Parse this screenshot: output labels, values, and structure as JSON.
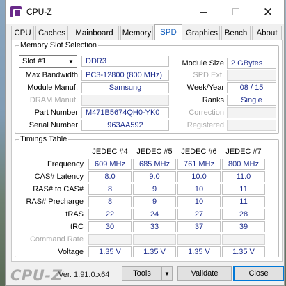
{
  "window": {
    "title": "CPU-Z",
    "minimize": "—",
    "maximize": "☐",
    "close": "✕"
  },
  "tabs": [
    "CPU",
    "Caches",
    "Mainboard",
    "Memory",
    "SPD",
    "Graphics",
    "Bench",
    "About"
  ],
  "active_tab": "SPD",
  "memory_slot": {
    "group_title": "Memory Slot Selection",
    "slot_selected": "Slot #1",
    "type": "DDR3",
    "labels": {
      "max_bandwidth": "Max Bandwidth",
      "module_manuf": "Module Manuf.",
      "dram_manuf": "DRAM Manuf.",
      "part_number": "Part Number",
      "serial_number": "Serial Number",
      "module_size": "Module Size",
      "spd_ext": "SPD Ext.",
      "week_year": "Week/Year",
      "ranks": "Ranks",
      "correction": "Correction",
      "registered": "Registered"
    },
    "values": {
      "max_bandwidth": "PC3-12800 (800 MHz)",
      "module_manuf": "Samsung",
      "dram_manuf": "",
      "part_number": "M471B5674QH0-YK0",
      "serial_number": "963AA592",
      "module_size": "2 GBytes",
      "spd_ext": "",
      "week_year": "08 / 15",
      "ranks": "Single",
      "correction": "",
      "registered": ""
    }
  },
  "timings": {
    "group_title": "Timings Table",
    "columns": [
      "JEDEC #4",
      "JEDEC #5",
      "JEDEC #6",
      "JEDEC #7"
    ],
    "rows": [
      {
        "label": "Frequency",
        "values": [
          "609 MHz",
          "685 MHz",
          "761 MHz",
          "800 MHz"
        ]
      },
      {
        "label": "CAS# Latency",
        "values": [
          "8.0",
          "9.0",
          "10.0",
          "11.0"
        ]
      },
      {
        "label": "RAS# to CAS#",
        "values": [
          "8",
          "9",
          "10",
          "11"
        ]
      },
      {
        "label": "RAS# Precharge",
        "values": [
          "8",
          "9",
          "10",
          "11"
        ]
      },
      {
        "label": "tRAS",
        "values": [
          "22",
          "24",
          "27",
          "28"
        ]
      },
      {
        "label": "tRC",
        "values": [
          "30",
          "33",
          "37",
          "39"
        ]
      },
      {
        "label": "Command Rate",
        "values": [
          "",
          "",
          "",
          ""
        ]
      },
      {
        "label": "Voltage",
        "values": [
          "1.35 V",
          "1.35 V",
          "1.35 V",
          "1.35 V"
        ]
      }
    ]
  },
  "footer": {
    "logo": "CPU-Z",
    "version": "Ver. 1.91.0.x64",
    "tools": "Tools",
    "tools_arrow": "▼",
    "validate": "Validate",
    "close": "Close"
  }
}
